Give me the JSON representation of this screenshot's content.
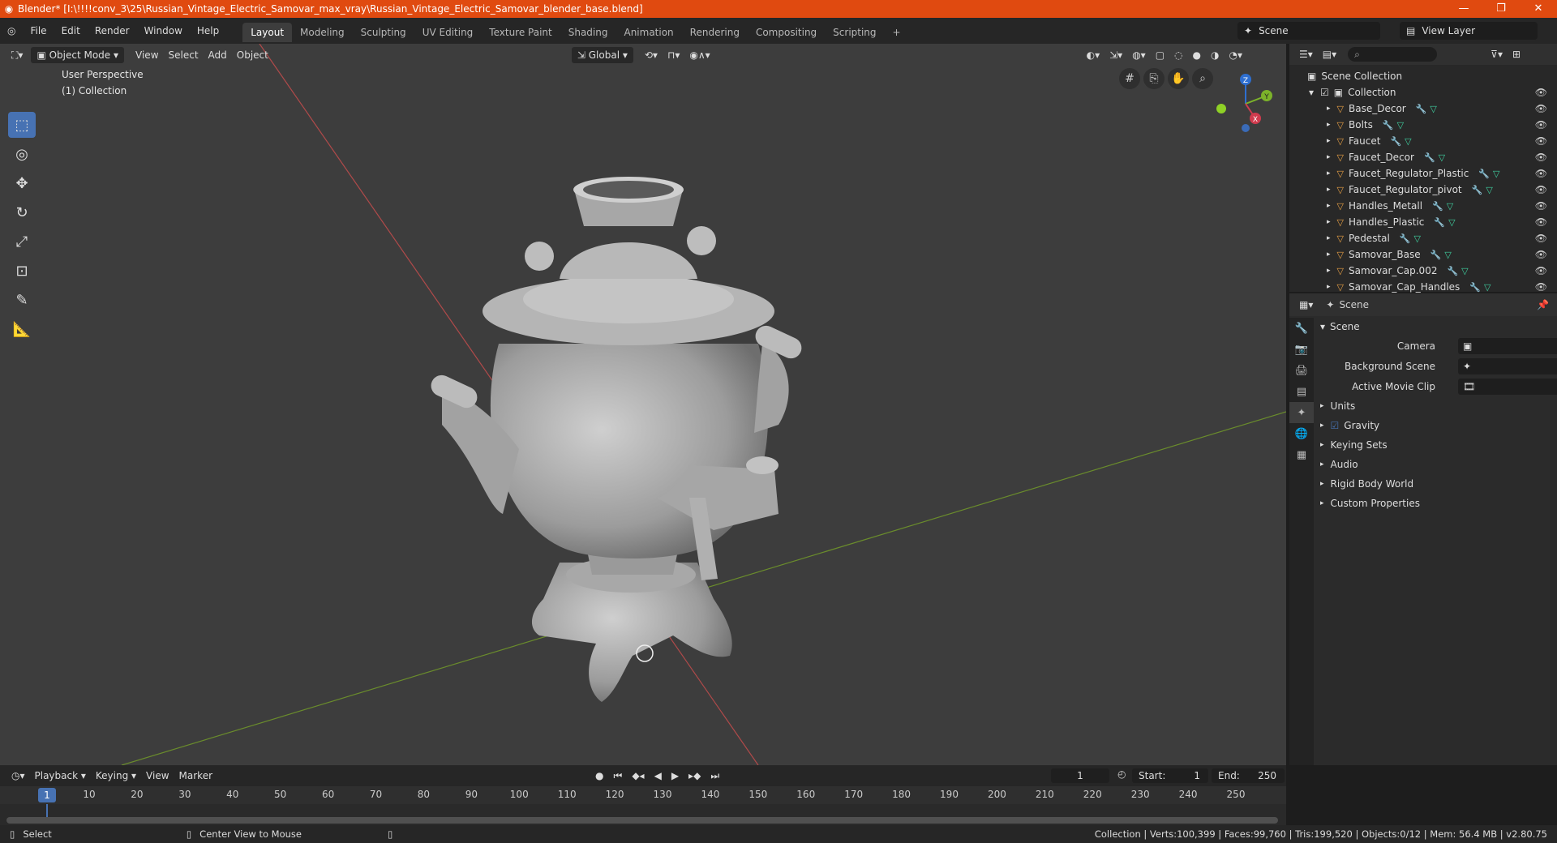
{
  "window": {
    "title": "Blender* [I:\\!!!!conv_3\\25\\Russian_Vintage_Electric_Samovar_max_vray\\Russian_Vintage_Electric_Samovar_blender_base.blend]",
    "minimize": "—",
    "maximize": "❐",
    "close": "✕"
  },
  "menu": [
    "File",
    "Edit",
    "Render",
    "Window",
    "Help"
  ],
  "workspaces": [
    "Layout",
    "Modeling",
    "Sculpting",
    "UV Editing",
    "Texture Paint",
    "Shading",
    "Animation",
    "Rendering",
    "Compositing",
    "Scripting"
  ],
  "workspace_add": "+",
  "scene_name": "Scene",
  "view_layer": "View Layer",
  "viewport": {
    "mode": "Object Mode",
    "menus": [
      "View",
      "Select",
      "Add",
      "Object"
    ],
    "transform_orientation": "Global",
    "perspective_label": "User Perspective",
    "collection_label": "(1) Collection",
    "gizmo": {
      "x": "X",
      "y": "Y",
      "z": "Z"
    }
  },
  "outliner": {
    "root": "Scene Collection",
    "collection": "Collection",
    "objects": [
      "Base_Decor",
      "Bolts",
      "Faucet",
      "Faucet_Decor",
      "Faucet_Regulator_Plastic",
      "Faucet_Regulator_pivot",
      "Handles_Metall",
      "Handles_Plastic",
      "Pedestal",
      "Samovar_Base",
      "Samovar_Cap.002",
      "Samovar_Cap_Handles"
    ]
  },
  "properties": {
    "context": "Scene",
    "panel_title": "Scene",
    "fields": [
      {
        "label": "Camera"
      },
      {
        "label": "Background Scene"
      },
      {
        "label": "Active Movie Clip"
      }
    ],
    "sections": [
      "Units",
      "Gravity",
      "Keying Sets",
      "Audio",
      "Rigid Body World",
      "Custom Properties"
    ]
  },
  "timeline": {
    "menus": [
      "Playback",
      "Keying",
      "View",
      "Marker"
    ],
    "current_frame": "1",
    "start_label": "Start:",
    "start": "1",
    "end_label": "End:",
    "end": "250",
    "ticks": [
      "10",
      "20",
      "30",
      "40",
      "50",
      "60",
      "70",
      "80",
      "90",
      "100",
      "110",
      "120",
      "130",
      "140",
      "150",
      "160",
      "170",
      "180",
      "190",
      "200",
      "210",
      "220",
      "230",
      "240",
      "250"
    ],
    "playhead_label": "1"
  },
  "statusbar": {
    "left": "Select",
    "middle": "Center View to Mouse",
    "right": "Collection | Verts:100,399 | Faces:99,760 | Tris:199,520 | Objects:0/12 | Mem: 56.4 MB | v2.80.75"
  }
}
